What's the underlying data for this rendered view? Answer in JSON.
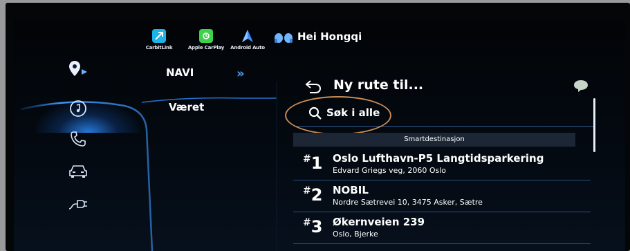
{
  "topbar": {
    "apps": [
      {
        "label": "CarbitLink",
        "icon": "carbitlink-icon",
        "color": "#1bb3e8"
      },
      {
        "label": "Apple CarPlay",
        "icon": "apple-carplay-icon",
        "color": "#3ed14a"
      },
      {
        "label": "Android Auto",
        "icon": "android-auto-icon",
        "color": "#3b8cff"
      }
    ],
    "greeting": "Hei Hongqi"
  },
  "rail": {
    "items": [
      {
        "icon": "navigation-pin-icon",
        "active": true
      },
      {
        "icon": "music-note-icon"
      },
      {
        "icon": "phone-icon"
      },
      {
        "icon": "car-icon"
      },
      {
        "icon": "ev-charging-plug-icon"
      }
    ]
  },
  "menu": {
    "items": [
      {
        "label": "NAVI",
        "active": true
      },
      {
        "label": "Været"
      }
    ],
    "expand_glyph": "»"
  },
  "content": {
    "title": "Ny rute til...",
    "search_label": "Søk i alle",
    "section_header": "Smartdestinasjon",
    "destinations": [
      {
        "hash": "#",
        "rank": "1",
        "name": "Oslo Lufthavn-P5 Langtidsparkering",
        "address": "Edvard Griegs veg, 2060 Oslo"
      },
      {
        "hash": "#",
        "rank": "2",
        "name": "NOBIL",
        "address": "Nordre Sætrevei 10, 3475 Asker, Sætre"
      },
      {
        "hash": "#",
        "rank": "3",
        "name": "Økernveien 239",
        "address": "Oslo, Bjerke"
      }
    ]
  },
  "colors": {
    "accent": "#2f8dff",
    "highlight_oval": "#c98d55"
  }
}
